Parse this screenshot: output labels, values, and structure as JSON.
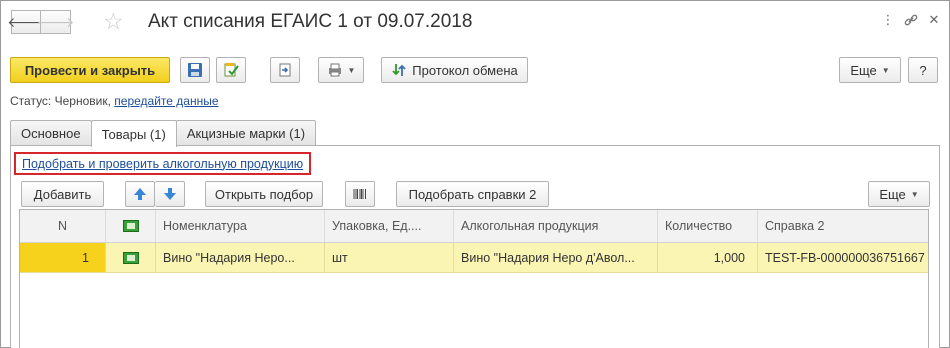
{
  "window": {
    "title": "Акт списания ЕГАИС 1 от 09.07.2018",
    "back_icon": "arrow-left-icon",
    "forward_icon": "arrow-right-icon",
    "favorite_icon": "star-icon",
    "more_icon": "dots-vertical-icon",
    "link_icon": "link-icon",
    "close_icon": "close-icon"
  },
  "toolbar": {
    "post_close_label": "Провести и закрыть",
    "exchange_protocol_label": "Протокол обмена",
    "more_label": "Еще",
    "help_label": "?"
  },
  "status": {
    "prefix": "Статус:",
    "value": "Черновик,",
    "action_link": "передайте данные"
  },
  "tabs": [
    {
      "label": "Основное"
    },
    {
      "label": "Товары (1)",
      "active": true
    },
    {
      "label": "Акцизные марки (1)"
    }
  ],
  "goods": {
    "pick_link": "Подобрать и проверить алкогольную продукцию",
    "add_label": "Добавить",
    "open_selection_label": "Открыть подбор",
    "pick_certificates_label": "Подобрать справки 2",
    "more_label": "Еще",
    "columns": [
      {
        "label": "N"
      },
      {
        "label": ""
      },
      {
        "label": "Номенклатура"
      },
      {
        "label": "Упаковка, Ед...."
      },
      {
        "label": "Алкогольная продукция"
      },
      {
        "label": "Количество"
      },
      {
        "label": "Справка 2"
      }
    ],
    "rows": [
      {
        "n": "1",
        "nomenclature": "Вино \"Надария Неро...",
        "package": "шт",
        "alcohol_product": "Вино \"Надария Неро д'Авол...",
        "quantity": "1,000",
        "certificate": "TEST-FB-000000036751667"
      }
    ]
  },
  "colors": {
    "primary_button": "#f2cf1d",
    "selected_row": "#fbf5b4",
    "row_number_highlight": "#f7d21c",
    "highlight_frame": "#d6252b",
    "link": "#1e4e9a"
  }
}
